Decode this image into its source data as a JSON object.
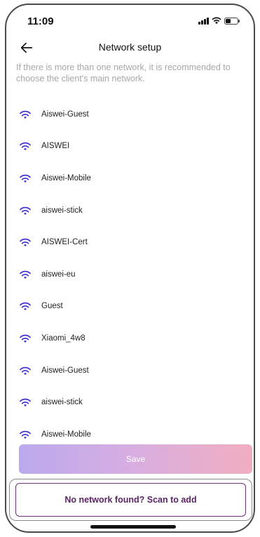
{
  "status_bar": {
    "time": "11:09"
  },
  "header": {
    "title": "Network setup"
  },
  "hint_text": "If there is more than one network, it is recommended to choose the client's main network.",
  "networks": [
    {
      "name": "Aiswei-Guest"
    },
    {
      "name": "AISWEI"
    },
    {
      "name": "Aiswei-Mobile"
    },
    {
      "name": "aiswei-stick"
    },
    {
      "name": "AISWEI-Cert"
    },
    {
      "name": "aiswei-eu"
    },
    {
      "name": "Guest"
    },
    {
      "name": "Xiaomi_4w8"
    },
    {
      "name": "Aiswei-Guest"
    },
    {
      "name": "aiswei-stick"
    },
    {
      "name": "Aiswei-Mobile"
    }
  ],
  "save_label": "Save",
  "scan_label": "No network found? Scan to add",
  "colors": {
    "wifi_icon": "#3b2fd6",
    "scan_border": "#6e3379",
    "save_gradient_start": "#bba9ee",
    "save_gradient_end": "#f2aec0"
  },
  "icons": {
    "back": "back-arrow-icon",
    "network": "wifi-icon"
  }
}
